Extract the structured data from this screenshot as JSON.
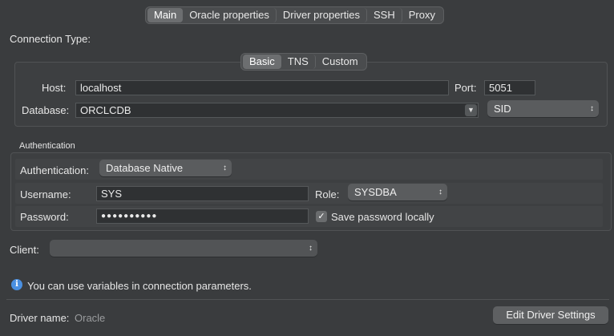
{
  "top_tabs": [
    {
      "label": "Main",
      "active": true
    },
    {
      "label": "Oracle properties",
      "active": false
    },
    {
      "label": "Driver properties",
      "active": false
    },
    {
      "label": "SSH",
      "active": false
    },
    {
      "label": "Proxy",
      "active": false
    }
  ],
  "connection_type": {
    "label": "Connection Type:",
    "tabs": [
      {
        "label": "Basic",
        "active": true
      },
      {
        "label": "TNS",
        "active": false
      },
      {
        "label": "Custom",
        "active": false
      }
    ],
    "host_label": "Host:",
    "host_value": "localhost",
    "port_label": "Port:",
    "port_value": "5051",
    "database_label": "Database:",
    "database_value": "ORCLCDB",
    "sid_value": "SID"
  },
  "authentication": {
    "section_title": "Authentication",
    "auth_label": "Authentication:",
    "auth_value": "Database Native",
    "username_label": "Username:",
    "username_value": "SYS",
    "role_label": "Role:",
    "role_value": "SYSDBA",
    "password_label": "Password:",
    "password_value": "●●●●●●●●●●",
    "save_password_label": "Save password locally",
    "save_password_checked": true
  },
  "client": {
    "label": "Client:",
    "value": ""
  },
  "info": {
    "icon": "info-icon",
    "text": "You can use variables in connection parameters."
  },
  "footer": {
    "driver_name_label": "Driver name:",
    "driver_name_value": "Oracle",
    "edit_driver_button": "Edit Driver Settings"
  },
  "colors": {
    "background": "#3a3c3e",
    "accent_info": "#4a90e2"
  }
}
